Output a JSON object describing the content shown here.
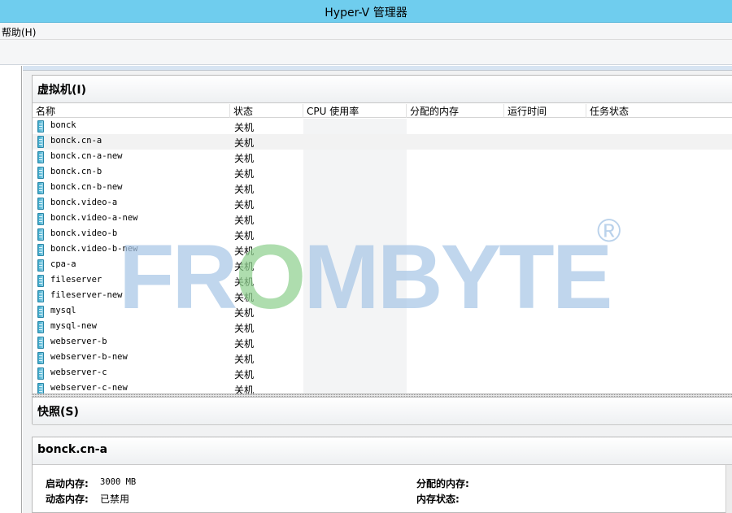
{
  "window": {
    "title": "Hyper-V 管理器"
  },
  "menu": {
    "help": "帮助(H)"
  },
  "vm_panel": {
    "title": "虚拟机(I)",
    "columns": [
      "名称",
      "状态",
      "CPU 使用率",
      "分配的内存",
      "运行时间",
      "任务状态"
    ],
    "rows": [
      {
        "name": "bonck",
        "state": "关机"
      },
      {
        "name": "bonck.cn-a",
        "state": "关机"
      },
      {
        "name": "bonck.cn-a-new",
        "state": "关机"
      },
      {
        "name": "bonck.cn-b",
        "state": "关机"
      },
      {
        "name": "bonck.cn-b-new",
        "state": "关机"
      },
      {
        "name": "bonck.video-a",
        "state": "关机"
      },
      {
        "name": "bonck.video-a-new",
        "state": "关机"
      },
      {
        "name": "bonck.video-b",
        "state": "关机"
      },
      {
        "name": "bonck.video-b-new",
        "state": "关机"
      },
      {
        "name": "cpa-a",
        "state": "关机"
      },
      {
        "name": "fileserver",
        "state": "关机"
      },
      {
        "name": "fileserver-new",
        "state": "关机"
      },
      {
        "name": "mysql",
        "state": "关机"
      },
      {
        "name": "mysql-new",
        "state": "关机"
      },
      {
        "name": "webserver-b",
        "state": "关机"
      },
      {
        "name": "webserver-b-new",
        "state": "关机"
      },
      {
        "name": "webserver-c",
        "state": "关机"
      },
      {
        "name": "webserver-c-new",
        "state": "关机"
      }
    ],
    "selected_row": 1
  },
  "snapshot_panel": {
    "title": "快照(S)"
  },
  "detail_panel": {
    "title": "bonck.cn-a",
    "startup_memory_label": "启动内存:",
    "startup_memory_value": "3000 MB",
    "dynamic_memory_label": "动态内存:",
    "dynamic_memory_value": "已禁用",
    "assigned_memory_label": "分配的内存:",
    "memory_status_label": "内存状态:"
  },
  "watermark": {
    "text_a": "FR",
    "text_o": "O",
    "text_b": "MBYTE",
    "reg": "®"
  },
  "colors": {
    "titlebar": "#6fcdee",
    "watermark_blue": "#a9c7e7",
    "watermark_green": "#8fd18f"
  }
}
